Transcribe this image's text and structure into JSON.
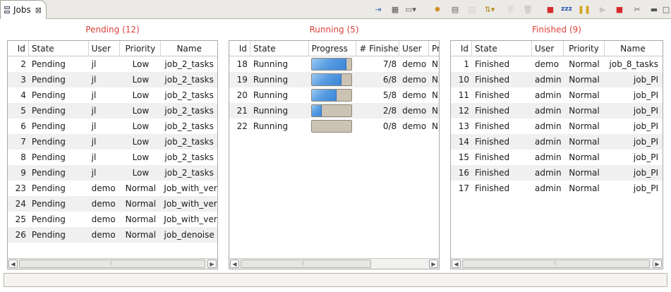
{
  "tab": {
    "label": "Jobs",
    "close": "⊠"
  },
  "toolbar": [
    {
      "name": "pin-icon",
      "glyph": "⇥",
      "color": "#3a6fb5",
      "disabled": false
    },
    {
      "name": "grid-icon",
      "glyph": "▦",
      "color": "#555555",
      "disabled": false
    },
    {
      "name": "layout-dropdown-icon",
      "glyph": "▭▾",
      "color": "#555555",
      "disabled": false
    },
    {
      "name": "submit-job-icon",
      "glyph": "✹",
      "color": "#d08a1a",
      "disabled": false
    },
    {
      "name": "job-info-icon",
      "glyph": "▤",
      "color": "#666666",
      "disabled": false
    },
    {
      "name": "job-output-icon",
      "glyph": "◫",
      "color": "#888888",
      "disabled": true
    },
    {
      "name": "priority-dropdown-icon",
      "glyph": "⇅▾",
      "color": "#b08a20",
      "disabled": false
    },
    {
      "name": "copy-icon",
      "glyph": "⎘",
      "color": "#888888",
      "disabled": true
    },
    {
      "name": "delete-icon",
      "glyph": "🗑",
      "color": "#888888",
      "disabled": true
    },
    {
      "name": "stop-icon",
      "glyph": "■",
      "color": "#d62a2a",
      "disabled": false
    },
    {
      "name": "sleep-icon",
      "glyph": "zzz",
      "color": "#2a55b5",
      "disabled": false
    },
    {
      "name": "pause-icon",
      "glyph": "❚❚",
      "color": "#d6a21a",
      "disabled": false
    },
    {
      "name": "resume-icon",
      "glyph": "▶",
      "color": "#9a9a9a",
      "disabled": true
    },
    {
      "name": "kill-job-icon",
      "glyph": "■",
      "color": "#d62a2a",
      "disabled": false
    },
    {
      "name": "disconnect-icon",
      "glyph": "✂",
      "color": "#666666",
      "disabled": false
    },
    {
      "name": "minimize-icon",
      "glyph": "▬",
      "color": "#555555",
      "disabled": false
    },
    {
      "name": "maximize-icon",
      "glyph": "□",
      "color": "#555555",
      "disabled": false
    }
  ],
  "pending": {
    "title": "Pending (12)",
    "columns": [
      "Id",
      "State",
      "User",
      "Priority",
      "Name"
    ],
    "rows": [
      [
        "2",
        "Pending",
        "jl",
        "Low",
        "job_2_tasks"
      ],
      [
        "3",
        "Pending",
        "jl",
        "Low",
        "job_2_tasks"
      ],
      [
        "4",
        "Pending",
        "jl",
        "Low",
        "job_2_tasks"
      ],
      [
        "5",
        "Pending",
        "jl",
        "Low",
        "job_2_tasks"
      ],
      [
        "6",
        "Pending",
        "jl",
        "Low",
        "job_2_tasks"
      ],
      [
        "7",
        "Pending",
        "jl",
        "Low",
        "job_2_tasks"
      ],
      [
        "8",
        "Pending",
        "jl",
        "Low",
        "job_2_tasks"
      ],
      [
        "9",
        "Pending",
        "jl",
        "Low",
        "job_2_tasks"
      ],
      [
        "23",
        "Pending",
        "demo",
        "Normal",
        "Job_with_veri"
      ],
      [
        "24",
        "Pending",
        "demo",
        "Normal",
        "Job_with_veri"
      ],
      [
        "25",
        "Pending",
        "demo",
        "Normal",
        "Job_with_veri"
      ],
      [
        "26",
        "Pending",
        "demo",
        "Normal",
        "job_denoise"
      ]
    ]
  },
  "running": {
    "title": "Running (5)",
    "columns": [
      "Id",
      "State",
      "Progress",
      "# Finishe",
      "User",
      "Pr"
    ],
    "rows": [
      {
        "id": "18",
        "state": "Running",
        "progress": 0.875,
        "finished": "7/8",
        "user": "demo",
        "pr": "N"
      },
      {
        "id": "19",
        "state": "Running",
        "progress": 0.75,
        "finished": "6/8",
        "user": "demo",
        "pr": "N"
      },
      {
        "id": "20",
        "state": "Running",
        "progress": 0.625,
        "finished": "5/8",
        "user": "demo",
        "pr": "N"
      },
      {
        "id": "21",
        "state": "Running",
        "progress": 0.25,
        "finished": "2/8",
        "user": "demo",
        "pr": "N"
      },
      {
        "id": "22",
        "state": "Running",
        "progress": 0.0,
        "finished": "0/8",
        "user": "demo",
        "pr": "N"
      }
    ]
  },
  "finished": {
    "title": "Finished (9)",
    "columns": [
      "Id",
      "State",
      "User",
      "Priority",
      "Name"
    ],
    "rows": [
      [
        "1",
        "Finished",
        "demo",
        "Normal",
        "job_8_tasks"
      ],
      [
        "10",
        "Finished",
        "admin",
        "Normal",
        "job_PI"
      ],
      [
        "11",
        "Finished",
        "admin",
        "Normal",
        "job_PI"
      ],
      [
        "12",
        "Finished",
        "admin",
        "Normal",
        "job_PI"
      ],
      [
        "13",
        "Finished",
        "admin",
        "Normal",
        "job_PI"
      ],
      [
        "14",
        "Finished",
        "admin",
        "Normal",
        "job_PI"
      ],
      [
        "15",
        "Finished",
        "admin",
        "Normal",
        "job_PI"
      ],
      [
        "16",
        "Finished",
        "admin",
        "Normal",
        "job_PI"
      ],
      [
        "17",
        "Finished",
        "admin",
        "Normal",
        "job_PI"
      ]
    ]
  },
  "colors": {
    "panel_title": "#d9413a",
    "progress_fill": "#4f95df",
    "progress_track": "#cdc3b5",
    "row_alt": "#f0f0f0"
  }
}
